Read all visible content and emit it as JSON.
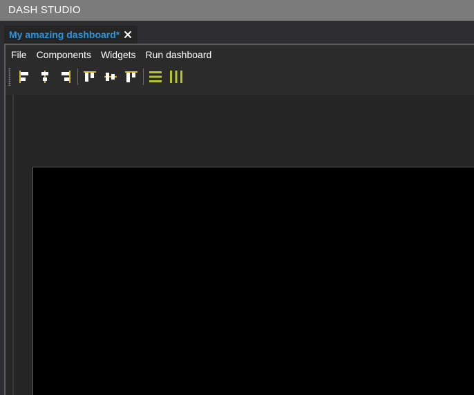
{
  "app": {
    "title": "DASH STUDIO"
  },
  "tab": {
    "label": "My amazing dashboard*",
    "close_icon": "close-icon"
  },
  "menu": {
    "items": [
      "File",
      "Components",
      "Widgets",
      "Run dashboard"
    ]
  },
  "toolbar": {
    "buttons": [
      "align-left-icon",
      "align-center-horizontal-icon",
      "align-right-icon",
      "align-top-icon",
      "align-middle-vertical-icon",
      "align-bottom-icon",
      "distribute-vertical-icon",
      "distribute-horizontal-icon"
    ],
    "accent_color": "#b5c62a"
  },
  "colors": {
    "titlebar": "#7b7b7b",
    "tab_text": "#2f93d6",
    "canvas": "#000000"
  }
}
